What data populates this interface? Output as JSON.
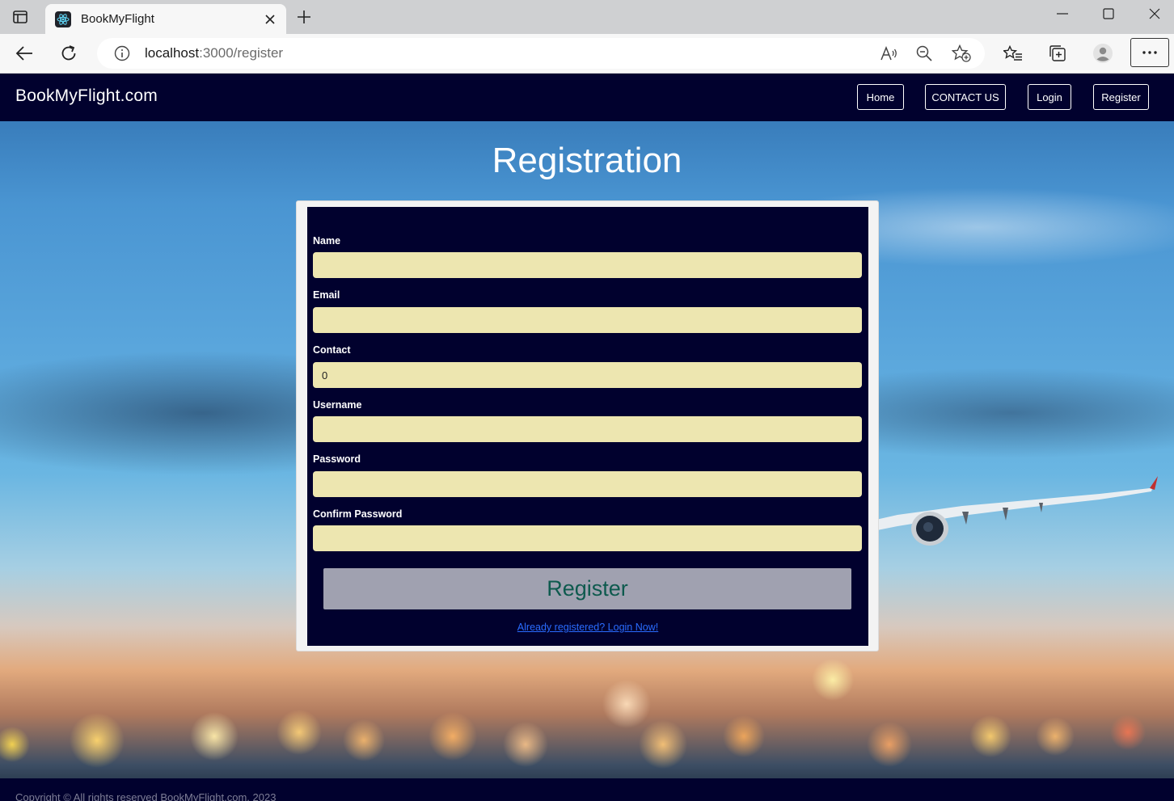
{
  "browser": {
    "tab_title": "BookMyFlight",
    "url_host": "localhost",
    "url_path": ":3000/register"
  },
  "navbar": {
    "brand": "BookMyFlight.com",
    "links": [
      "Home",
      "CONTACT US",
      "Login",
      "Register"
    ]
  },
  "page": {
    "title": "Registration"
  },
  "form": {
    "fields": [
      {
        "label": "Name",
        "value": ""
      },
      {
        "label": "Email",
        "value": ""
      },
      {
        "label": "Contact",
        "value": "0"
      },
      {
        "label": "Username",
        "value": ""
      },
      {
        "label": "Password",
        "value": ""
      },
      {
        "label": "Confirm Password",
        "value": ""
      }
    ],
    "submit_label": "Register",
    "login_link": "Already registered? Login Now!"
  },
  "footer": {
    "text": "Copyright © All rights reserved BookMyFlight.com, 2023"
  },
  "colors": {
    "navbar_bg": "#01012e",
    "input_bg": "#ede6b0",
    "button_bg": "#a0a1b0",
    "button_text": "#0e5a4e",
    "link": "#2a6cff"
  },
  "icons": [
    "tab-actions-icon",
    "react-logo-icon",
    "close-icon",
    "plus-icon",
    "minimize-icon",
    "maximize-icon",
    "back-arrow-icon",
    "refresh-icon",
    "info-icon",
    "read-aloud-icon",
    "zoom-out-icon",
    "add-favorite-icon",
    "favorites-icon",
    "collections-icon",
    "profile-icon",
    "more-icon"
  ]
}
